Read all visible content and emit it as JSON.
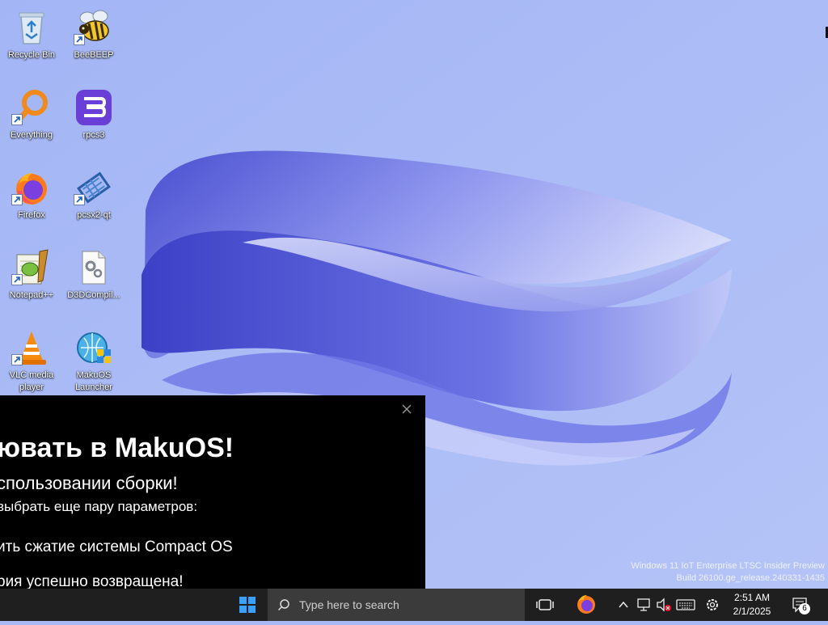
{
  "desktop": {
    "icons": [
      {
        "label": "Recycle Bin",
        "icon": "recycle-bin-icon"
      },
      {
        "label": "BeeBEEP",
        "icon": "bee-icon"
      },
      {
        "label": "Everything",
        "icon": "magnifier-icon"
      },
      {
        "label": "rpcs3",
        "icon": "rpcs3-icon"
      },
      {
        "label": "Firefox",
        "icon": "firefox-icon"
      },
      {
        "label": "pcsx2-qt",
        "icon": "pcsx2-icon"
      },
      {
        "label": "Notepad++",
        "icon": "notepad-plus-plus-icon"
      },
      {
        "label": "D3DCompil...",
        "icon": "system-file-icon"
      },
      {
        "label": "VLC media player",
        "icon": "vlc-icon"
      },
      {
        "label": "MakuOS Launcher",
        "icon": "makuos-launcher-icon"
      }
    ],
    "watermark": {
      "line1": "Windows 11 IoT Enterprise LTSC Insider Preview",
      "line2": "Build 26100.ge_release.240331-1435"
    }
  },
  "popup": {
    "title": "ювать в MakuOS!",
    "subtitle": "спользовании сборки!",
    "line1": "выбрать еще пару параметров:",
    "line2": "ить сжатие системы Compact OS",
    "line3": "рия успешно возвращена!"
  },
  "taskbar": {
    "search_placeholder": "Type here to search",
    "time": "2:51 AM",
    "date": "2/1/2025",
    "notification_count": "6"
  },
  "colors": {
    "wallpaper": "#a9b9f6",
    "taskbar": "#1f1f1f",
    "popup_bg": "#000000"
  }
}
